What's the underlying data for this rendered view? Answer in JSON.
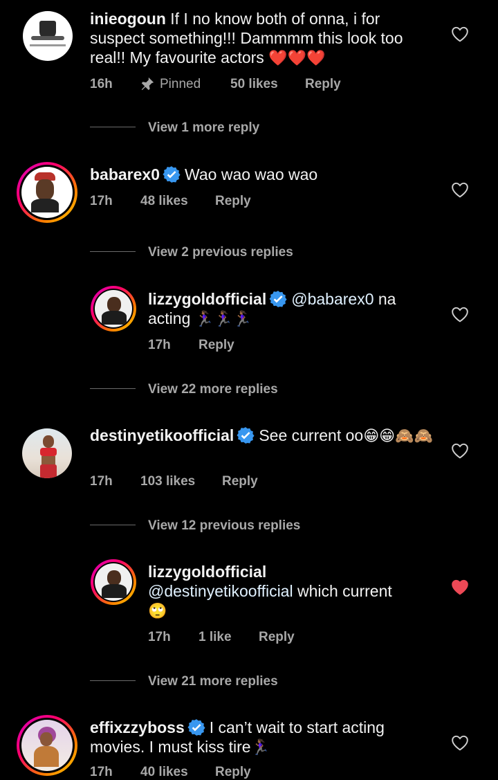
{
  "comments": [
    {
      "username": "inieogoun",
      "text": "If I no know both of onna, i for suspect something!!! Dammmm this look too real!! My favourite actors",
      "emoji": "❤️❤️❤️",
      "time": "16h",
      "pinned": "Pinned",
      "likes": "50 likes",
      "reply": "Reply",
      "view_more": "View 1 more reply"
    },
    {
      "username": "babarex0",
      "text": "Wao wao wao wao",
      "time": "17h",
      "likes": "48 likes",
      "reply": "Reply",
      "view_previous": "View 2 previous replies"
    },
    {
      "username": "lizzygoldofficial",
      "mention": "@babarex0",
      "text": " na acting",
      "emoji": "🏃🏾‍♀️🏃🏾‍♀️🏃🏾‍♀️",
      "time": "17h",
      "reply": "Reply",
      "view_more": "View 22 more replies"
    },
    {
      "username": "destinyetikoofficial",
      "text": "See current oo",
      "emoji": "😁😁🙈🙈",
      "time": "17h",
      "likes": "103 likes",
      "reply": "Reply",
      "view_previous": "View 12 previous replies"
    },
    {
      "username": "lizzygoldofficial",
      "mention": "@destinyetikoofficial",
      "text": " which current",
      "emoji": "🙄",
      "time": "17h",
      "likes": "1 like",
      "reply": "Reply",
      "view_more": "View 21 more replies",
      "liked": true
    },
    {
      "username": "effixzzyboss",
      "text": "I can’t wait to start acting movies. I must kiss tire",
      "emoji": "🏃🏾‍♀️",
      "time": "17h",
      "likes": "40 likes",
      "reply": "Reply"
    }
  ],
  "icons": {
    "heart": "heart-icon",
    "pin": "pin-icon",
    "verified": "verified-badge-icon"
  },
  "colors": {
    "liked_heart": "#ed4956",
    "verified_blue": "#3897f0",
    "meta_gray": "#a8a8a8"
  }
}
